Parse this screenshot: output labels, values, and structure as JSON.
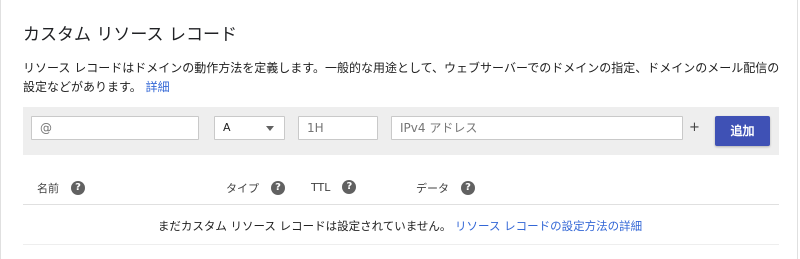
{
  "title": "カスタム リソース レコード",
  "description": {
    "text": "リソース レコードはドメインの動作方法を定義します。一般的な用途として、ウェブサーバーでのドメインの指定、ドメインのメール配信の設定などがあります。",
    "link": "詳細"
  },
  "form": {
    "host_placeholder": "@",
    "type_value": "A",
    "ttl_placeholder": "1H",
    "data_placeholder": "IPv4 アドレス",
    "plus_label": "+",
    "add_button": "追加"
  },
  "columns": {
    "name": "名前",
    "type": "タイプ",
    "ttl": "TTL",
    "data": "データ"
  },
  "help_icon_glyph": "?",
  "empty_state": {
    "text": "まだカスタム リソース レコードは設定されていません。",
    "link": "リソース レコードの設定方法の詳細"
  },
  "colors": {
    "accent": "#3f51b5",
    "link": "#3367d6",
    "bar_background": "#eeeeee"
  }
}
